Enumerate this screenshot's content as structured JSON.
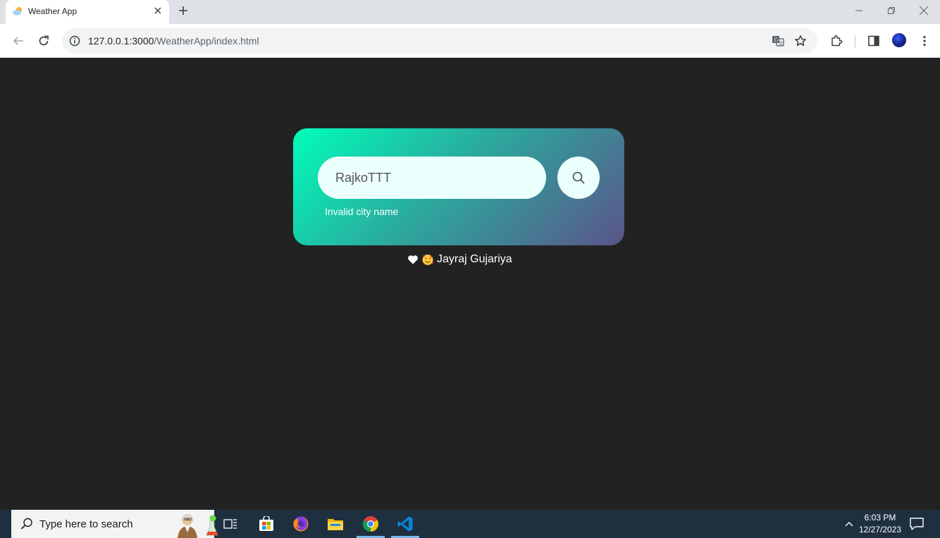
{
  "browser": {
    "tab_title": "Weather App",
    "url_host": "127.0.0.1:3000",
    "url_path": "/WeatherApp/index.html"
  },
  "app": {
    "search_value": "RajkoTTT",
    "error_message": "Invalid city name",
    "footer_name": "Jayraj Gujariya",
    "gradient_colors": [
      "#00feba",
      "#5b548a"
    ],
    "input_bg": "#ebfffc",
    "page_bg": "#222222"
  },
  "taskbar": {
    "search_placeholder": "Type here to search",
    "time": "6:03 PM",
    "date": "12/27/2023"
  }
}
